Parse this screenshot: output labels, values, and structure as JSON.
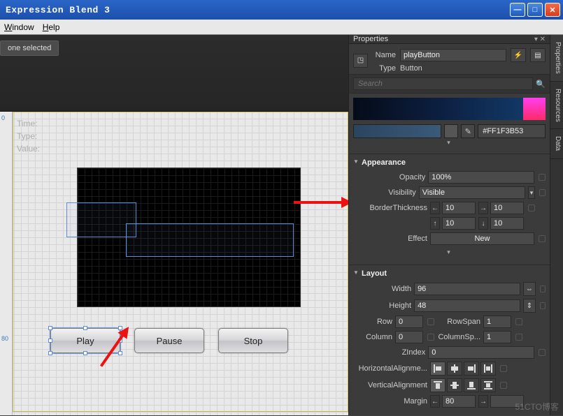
{
  "window": {
    "title": "Expression Blend 3"
  },
  "menu": {
    "window": "Window",
    "help": "Help"
  },
  "left": {
    "chip": "one selected",
    "labels": {
      "time": "Time:",
      "type": "Type:",
      "value": "Value:"
    },
    "ruler": {
      "m1": "0",
      "m2": "80"
    },
    "buttons": {
      "play": "Play",
      "pause": "Pause",
      "stop": "Stop"
    }
  },
  "panel": {
    "title": "Properties",
    "name_label": "Name",
    "name_value": "playButton",
    "type_label": "Type",
    "type_value": "Button",
    "search_placeholder": "Search",
    "hex": "#FF1F3B53",
    "appearance": {
      "title": "Appearance",
      "opacity_label": "Opacity",
      "opacity_value": "100%",
      "visibility_label": "Visibility",
      "visibility_value": "Visible",
      "border_label": "BorderThickness",
      "bt_l": "10",
      "bt_r": "10",
      "bt_t": "10",
      "bt_b": "10",
      "effect_label": "Effect",
      "effect_value": "New"
    },
    "layout": {
      "title": "Layout",
      "width_label": "Width",
      "width_value": "96",
      "height_label": "Height",
      "height_value": "48",
      "row_label": "Row",
      "row_value": "0",
      "rowspan_label": "RowSpan",
      "rowspan_value": "1",
      "col_label": "Column",
      "col_value": "0",
      "colspan_label": "ColumnSp...",
      "colspan_value": "1",
      "zindex_label": "ZIndex",
      "zindex_value": "0",
      "halign_label": "HorizontalAlignme...",
      "valign_label": "VerticalAlignment",
      "margin_label": "Margin",
      "margin_l": "80"
    }
  },
  "sidetabs": {
    "properties": "Properties",
    "resources": "Resources",
    "data": "Data"
  },
  "watermark": "51CTO博客"
}
